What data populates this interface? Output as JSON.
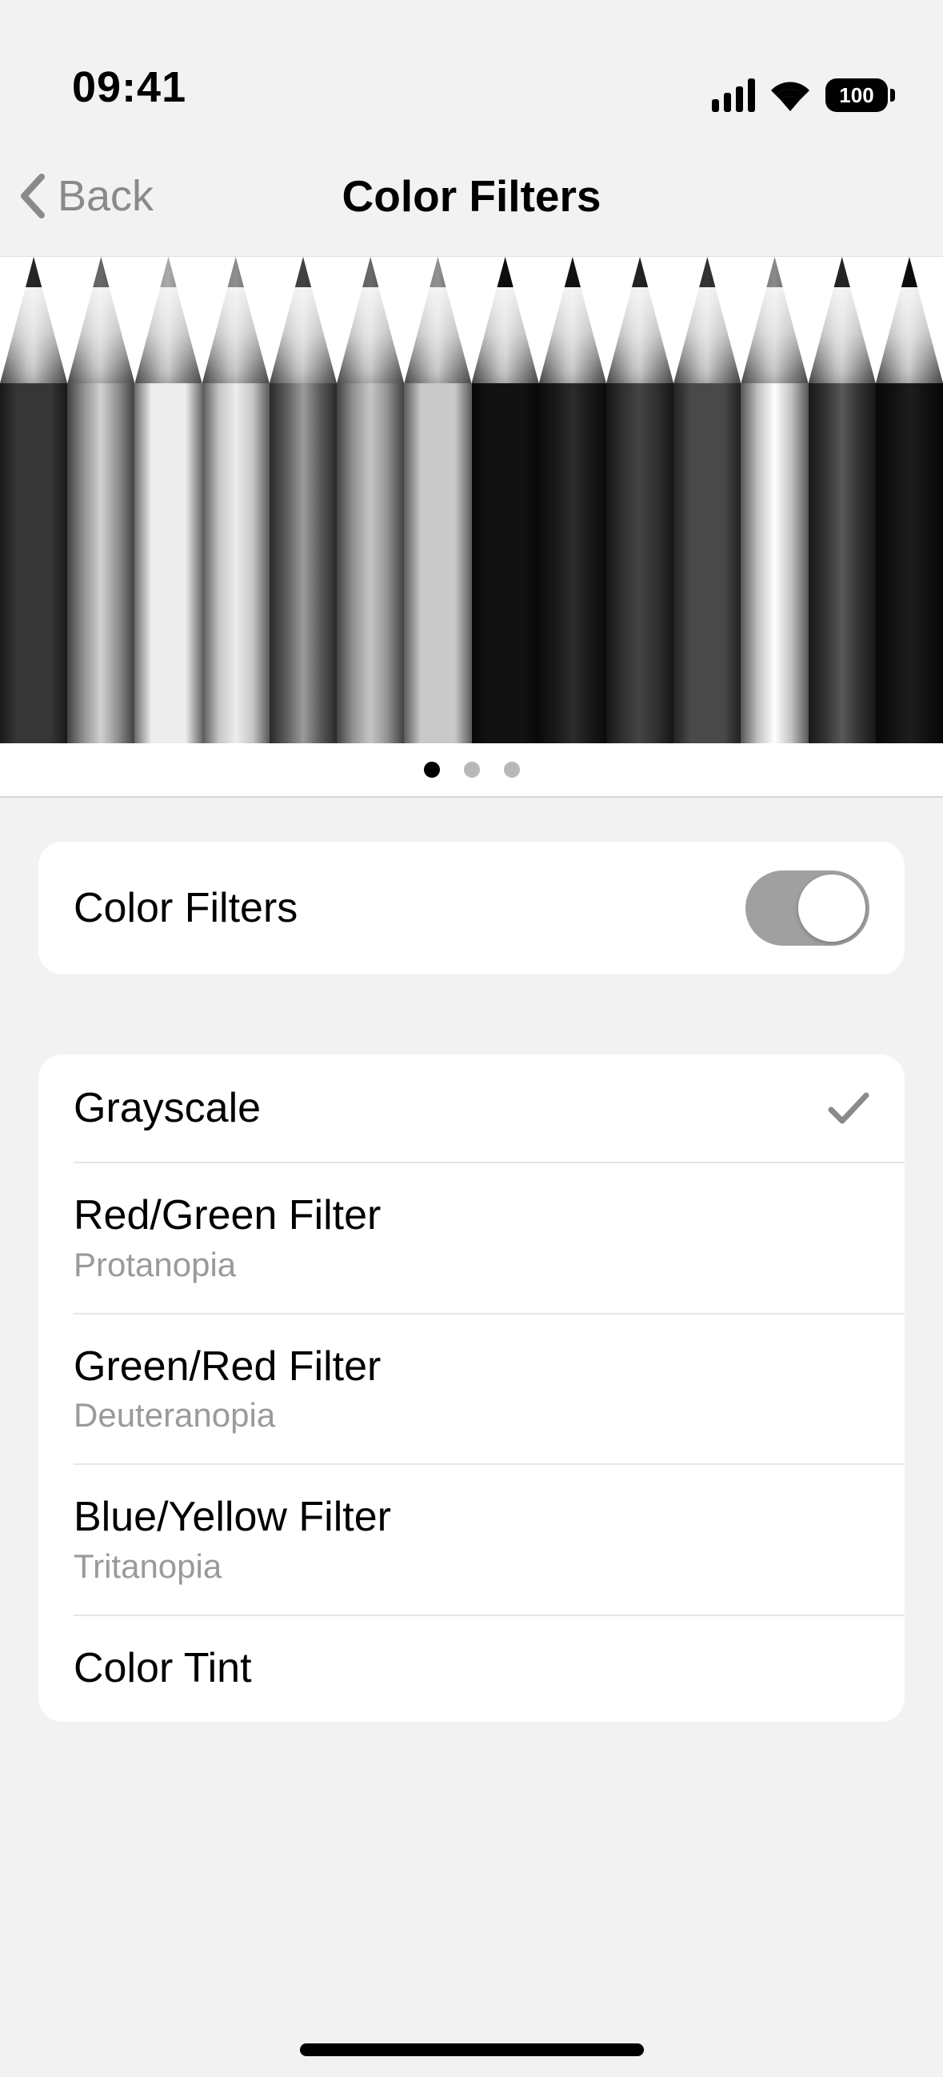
{
  "status": {
    "time": "09:41",
    "battery": "100"
  },
  "nav": {
    "back_label": "Back",
    "title": "Color Filters"
  },
  "preview": {
    "pencils": [
      "#ff0000",
      "#ff7f00",
      "#ffff00",
      "#b0e000",
      "#008000",
      "#00c080",
      "#00ffff",
      "#0000ff",
      "#4b0082",
      "#8b00ff",
      "#ff00ff",
      "#c0c0c0",
      "#303060",
      "#101020"
    ],
    "page_count": 3,
    "active_page": 0
  },
  "toggle_group": {
    "label": "Color Filters",
    "on": true
  },
  "filters": [
    {
      "label": "Grayscale",
      "sub": "",
      "selected": true
    },
    {
      "label": "Red/Green Filter",
      "sub": "Protanopia",
      "selected": false
    },
    {
      "label": "Green/Red Filter",
      "sub": "Deuteranopia",
      "selected": false
    },
    {
      "label": "Blue/Yellow Filter",
      "sub": "Tritanopia",
      "selected": false
    },
    {
      "label": "Color Tint",
      "sub": "",
      "selected": false
    }
  ]
}
